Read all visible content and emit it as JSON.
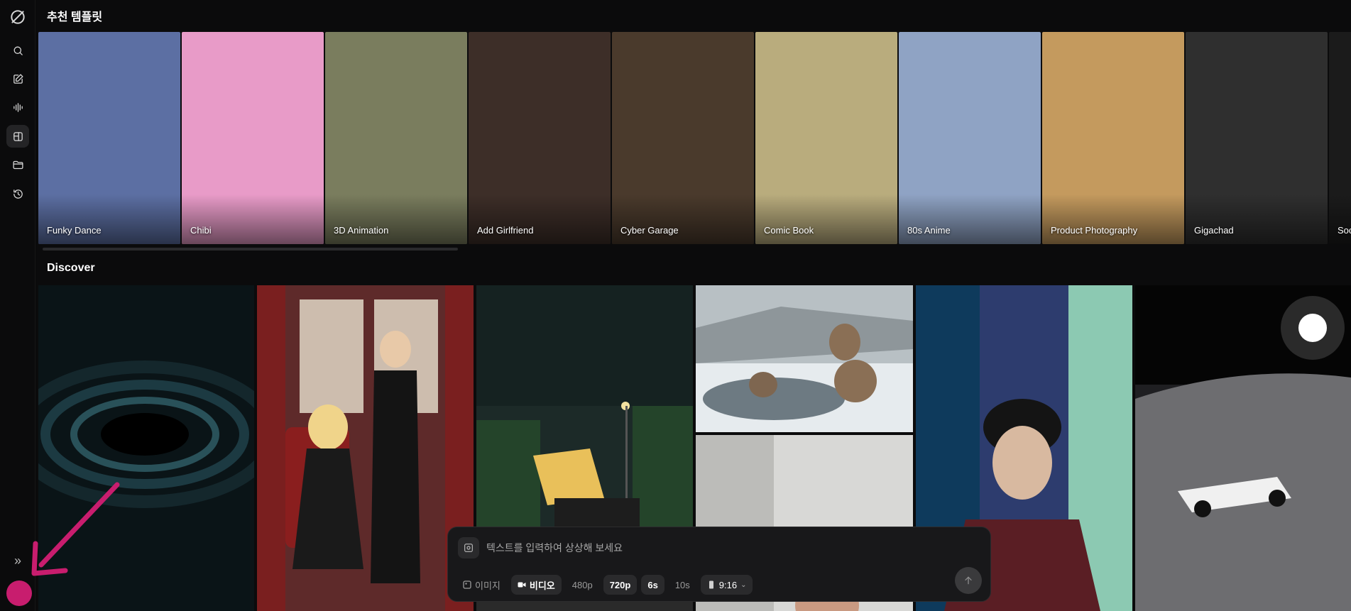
{
  "sidebar": {
    "icons": [
      "logo-icon",
      "search-icon",
      "edit-icon",
      "audio-wave-icon",
      "templates-icon",
      "folder-icon",
      "history-icon"
    ],
    "expand_label": "»"
  },
  "sections": {
    "templates_title": "추천 템플릿",
    "discover_title": "Discover"
  },
  "templates": [
    {
      "label": "Funky Dance",
      "bg": "#5c6fa3"
    },
    {
      "label": "Chibi",
      "bg": "#e89bc8"
    },
    {
      "label": "3D Animation",
      "bg": "#7a7d5e"
    },
    {
      "label": "Add Girlfriend",
      "bg": "#3d2e28"
    },
    {
      "label": "Cyber Garage",
      "bg": "#4a3a2c"
    },
    {
      "label": "Comic Book",
      "bg": "#b9ac7d"
    },
    {
      "label": "80s Anime",
      "bg": "#8fa3c4"
    },
    {
      "label": "Product Photography",
      "bg": "#c49a5e"
    },
    {
      "label": "Gigachad",
      "bg": "#2f2f2f"
    },
    {
      "label": "Soc",
      "bg": "#1b1b1b"
    }
  ],
  "discover_colors": {
    "blackhole": "#0a1417",
    "anime": "#5e2a2a",
    "pixel": "#1c2a28",
    "monkeys": "#b8c0c4",
    "white": "#d8d8d6",
    "portrait": "#2d3c6e",
    "moon": "#1f1f22"
  },
  "prompt": {
    "placeholder": "텍스트를 입력하여 상상해 보세요",
    "chips": [
      {
        "label": "이미지",
        "active": false,
        "icon": "image-icon"
      },
      {
        "label": "비디오",
        "active": true,
        "icon": "video-icon"
      },
      {
        "label": "480p",
        "active": false
      },
      {
        "label": "720p",
        "active": true
      },
      {
        "label": "6s",
        "active": true
      },
      {
        "label": "10s",
        "active": false
      },
      {
        "label": "9:16",
        "active": true,
        "icon": "aspect-icon"
      }
    ]
  },
  "colors": {
    "accent": "#c81d6e",
    "background": "#0b0b0c"
  }
}
